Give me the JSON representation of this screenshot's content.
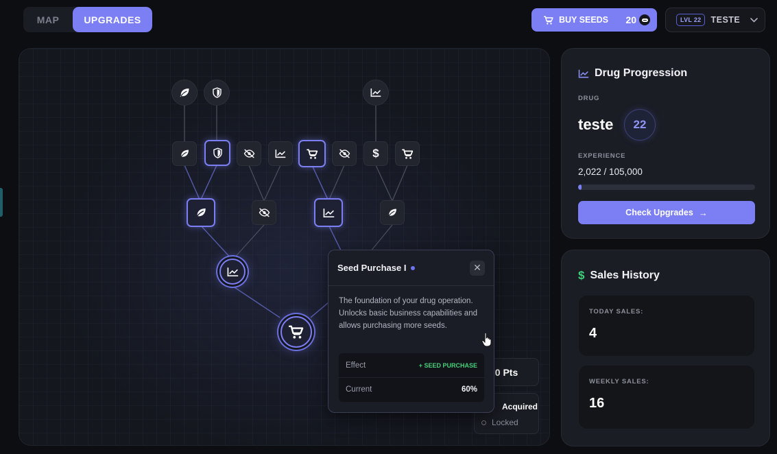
{
  "tabs": [
    {
      "label": "MAP",
      "active": false
    },
    {
      "label": "UPGRADES",
      "active": true
    }
  ],
  "buy_seeds": {
    "label": "BUY SEEDS",
    "count": "20",
    "icon": "cart-icon"
  },
  "user": {
    "level_badge": "LVL 22",
    "name": "TESTE"
  },
  "tree": {
    "points": "0 Pts",
    "legend": {
      "acquired": "Acquired",
      "locked": "Locked"
    }
  },
  "tooltip": {
    "title": "Seed Purchase I",
    "close": "✕",
    "description": "The foundation of your drug operation. Unlocks basic business capabilities and allows purchasing more seeds.",
    "effect_label": "Effect",
    "effect_value": "+ SEED PURCHASE",
    "current_label": "Current",
    "current_value": "60%"
  },
  "progression": {
    "title": "Drug Progression",
    "drug_label": "DRUG",
    "drug_name": "teste",
    "drug_level": "22",
    "experience_label": "EXPERIENCE",
    "experience_value": "2,022 / 105,000",
    "experience_fraction": 0.019,
    "button_label": "Check Upgrades",
    "button_arrow": "→"
  },
  "sales": {
    "title": "Sales History",
    "today_label": "TODAY SALES:",
    "today_value": "4",
    "weekly_label": "WEEKLY SALES:",
    "weekly_value": "16"
  },
  "colors": {
    "accent": "#7b7ff3",
    "background": "#0d0e11",
    "success": "#45d07a"
  }
}
